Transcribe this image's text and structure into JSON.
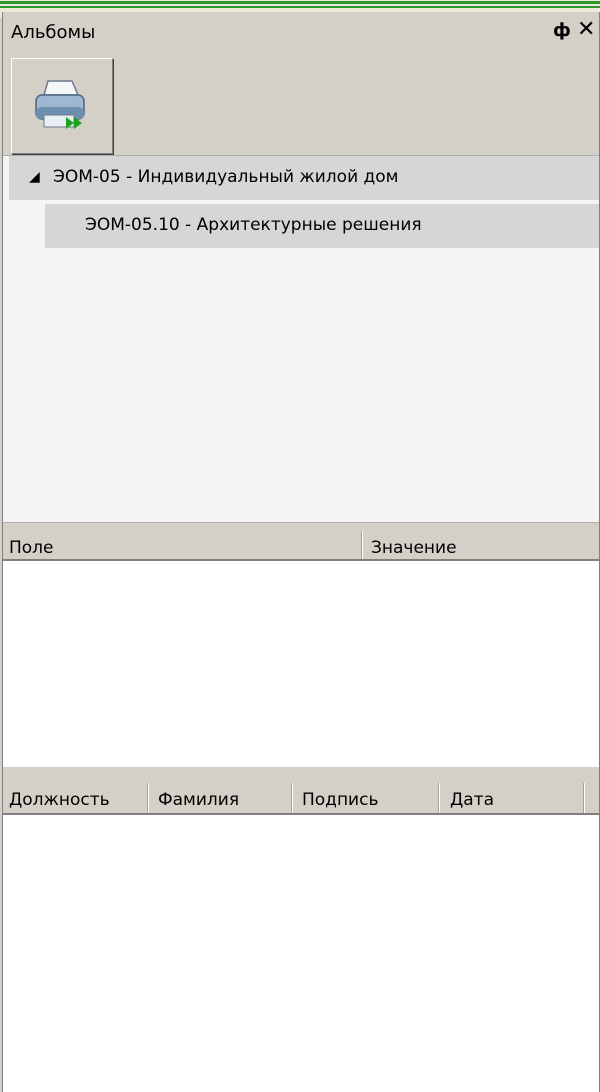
{
  "panel": {
    "title": "Альбомы",
    "pin_glyph": "ф",
    "close_glyph": "✕"
  },
  "toolbar": {
    "print_button_icon": "printer-forward-icon"
  },
  "tree": {
    "root": {
      "expander": "◢",
      "label": "ЭОМ-05 - Индивидуальный жилой дом",
      "expanded": true
    },
    "children": [
      {
        "label": "ЭОМ-05.10 - Архитектурные решения"
      }
    ]
  },
  "properties": {
    "columns": [
      "Поле",
      "Значение"
    ],
    "rows": []
  },
  "signatures": {
    "columns": [
      "Должность",
      "Фамилия",
      "Подпись",
      "Дата"
    ],
    "rows": []
  },
  "colors": {
    "accent_green": "#2e9a2e",
    "panel_bg": "#d4d0c8",
    "tree_selection": "#d6d6d6"
  }
}
